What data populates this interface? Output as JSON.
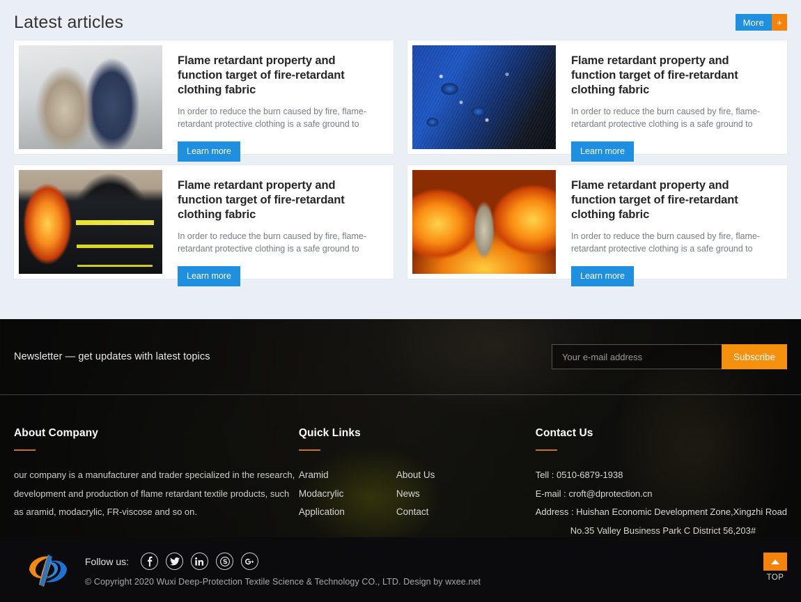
{
  "articles_section": {
    "title": "Latest articles",
    "more_button": {
      "label": "More",
      "plus": "+"
    },
    "cards": [
      {
        "title": "Flame retardant property and function target of fire-retardant clothing fabric",
        "excerpt": "In order to reduce the burn caused by fire, flame-retardant protective clothing is a safe ground to",
        "button": "Learn more",
        "image_alt": "firefighters-in-smoke-photo"
      },
      {
        "title": "Flame retardant property and function target of fire-retardant clothing fabric",
        "excerpt": "In order to reduce the burn caused by fire, flame-retardant protective clothing is a safe ground to",
        "button": "Learn more",
        "image_alt": "water-droplets-on-blue-fabric-photo"
      },
      {
        "title": "Flame retardant property and function target of fire-retardant clothing fabric",
        "excerpt": "In order to reduce the burn caused by fire, flame-retardant protective clothing is a safe ground to",
        "button": "Learn more",
        "image_alt": "firefighter-beside-flames-photo"
      },
      {
        "title": "Flame retardant property and function target of fire-retardant clothing fabric",
        "excerpt": "In order to reduce the burn caused by fire, flame-retardant protective clothing is a safe ground to",
        "button": "Learn more",
        "image_alt": "firefighter-surrounded-by-blaze-photo"
      }
    ]
  },
  "newsletter": {
    "text": "Newsletter — get updates with latest topics",
    "email_placeholder": "Your e-mail address",
    "email_value": "",
    "subscribe_label": "Subscribe"
  },
  "footer": {
    "about": {
      "heading": "About Company",
      "text": "our company is a manufacturer and trader specialized in the research, development and production of flame retardant textile products, such as aramid, modacrylic, FR-viscose and so on."
    },
    "quick_links": {
      "heading": "Quick Links",
      "left": [
        "Aramid",
        "Modacrylic",
        "Application"
      ],
      "right": [
        "About Us",
        "News",
        "Contact"
      ]
    },
    "contact": {
      "heading": "Contact Us",
      "tel": "Tell : 0510-6879-1938",
      "email": "E-mail : croft@dprotection.cn",
      "address_line1": "Address : Huishan Economic Development Zone,Xingzhi Road",
      "address_line2": "No.35 Valley Business Park C District 56,203#"
    }
  },
  "bottom_bar": {
    "follow_label": "Follow us:",
    "social": [
      {
        "name": "facebook-icon",
        "glyph": "f"
      },
      {
        "name": "twitter-icon",
        "glyph": "❧"
      },
      {
        "name": "linkedin-icon",
        "glyph": "in"
      },
      {
        "name": "skype-icon",
        "glyph": "S"
      },
      {
        "name": "google-plus-icon",
        "glyph": "G"
      }
    ],
    "copyright": "© Copyright 2020  Wuxi Deep-Protection Textile Science & Technology CO., LTD.   Design by wxee.net",
    "top_label": "TOP"
  },
  "colors": {
    "page_bg": "#eaeef5",
    "card_bg": "#ffffff",
    "accent_blue": "#1f8fe0",
    "accent_orange": "#f5820b",
    "footer_rule": "#c5742a",
    "bottom_bar_bg": "#0b0b0d"
  }
}
